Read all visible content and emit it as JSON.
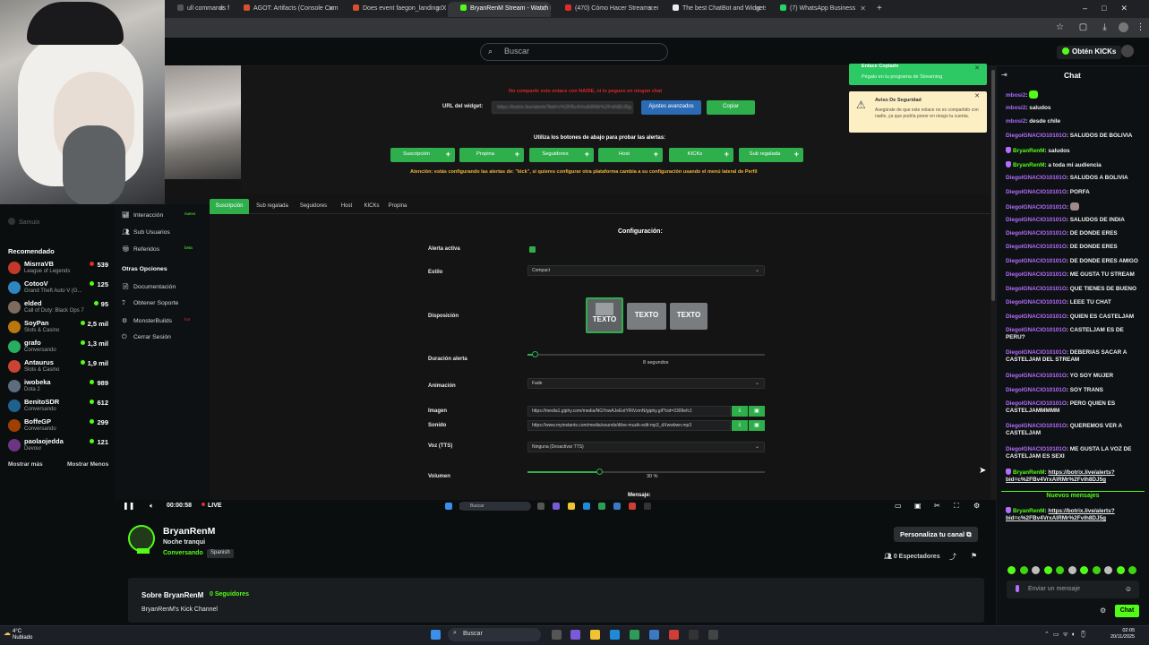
{
  "browser": {
    "tabs": [
      {
        "label": "ull commands for Cl",
        "active": false
      },
      {
        "label": "AGOT: Artifacts (Console Comm",
        "active": false
      },
      {
        "label": "Does event faegon_landing.007",
        "active": false
      },
      {
        "label": "BryanRenM Stream - Watch Liv",
        "active": true
      },
      {
        "label": "(470) Cómo Hacer Streams en",
        "active": false
      },
      {
        "label": "The best ChatBot and Widgets",
        "active": false
      },
      {
        "label": "(7) WhatsApp Business",
        "active": false
      }
    ],
    "new_tab": "+"
  },
  "header": {
    "search_placeholder": "Buscar",
    "get_kicks": "Obtén KICKs"
  },
  "sidebar": {
    "user": "Samuix",
    "recommended_title": "Recomendado",
    "channels": [
      {
        "name": "MisrraVB",
        "game": "League of Legends",
        "viewers": "539",
        "color": "#c0392b"
      },
      {
        "name": "CotooV",
        "game": "Grand Theft Auto V (G...",
        "viewers": "125",
        "color": "#2e86c1"
      },
      {
        "name": "elded",
        "game": "Call of Duty: Black Ops 7",
        "viewers": "95",
        "color": "#7d6b5d"
      },
      {
        "name": "SoyPan",
        "game": "Slots & Casino",
        "viewers": "2,5 mil",
        "color": "#b9770e"
      },
      {
        "name": "grafo",
        "game": "Conversando",
        "viewers": "1,3 mil",
        "color": "#27ae60"
      },
      {
        "name": "Antaurus",
        "game": "Slots & Casino",
        "viewers": "1,9 mil",
        "color": "#cb4335"
      },
      {
        "name": "iwobeka",
        "game": "Dota 2",
        "viewers": "989",
        "color": "#5d6d7e"
      },
      {
        "name": "BenitoSDR",
        "game": "Conversando",
        "viewers": "612",
        "color": "#1f618d"
      },
      {
        "name": "BoffeGP",
        "game": "Conversando",
        "viewers": "299",
        "color": "#a04000"
      },
      {
        "name": "paolaojedda",
        "game": "Devour",
        "viewers": "121",
        "color": "#6c3483"
      }
    ],
    "show_more": "Mostrar más",
    "show_less": "Mostrar Menos"
  },
  "dashboard": {
    "side_items": [
      {
        "label": "Interacción",
        "icon": "chart-icon",
        "tag": "nuevo"
      },
      {
        "label": "Sub Usuarios",
        "icon": "users-icon",
        "tag": ""
      },
      {
        "label": "Referidos",
        "icon": "gift-icon",
        "tag": "beta"
      },
      {
        "label": "Otras Opciones",
        "icon": "",
        "tag": ""
      },
      {
        "label": "Documentación",
        "icon": "doc-icon",
        "tag": ""
      },
      {
        "label": "Obtener Soporte",
        "icon": "help-icon",
        "tag": ""
      },
      {
        "label": "MonsterBuilds",
        "icon": "build-icon",
        "tag": "hot"
      },
      {
        "label": "Cerrar Sesión",
        "icon": "logout-icon",
        "tag": ""
      }
    ],
    "warning": "No compartir este enlace con NADIE, ni lo pegues en ningún chat",
    "url_label": "URL del widget:",
    "url_value": "https://botrix.live/alerts?bid=c%2FBv4VrxAIRMr%2Fvih8DJ5g",
    "advanced_button": "Ajustes avanzados",
    "copy_button": "Copiar",
    "test_caption": "Utiliza los botones de abajo para probar las alertas:",
    "test_buttons": [
      "Suscripción",
      "Propina",
      "Seguidores",
      "Host",
      "KICKs",
      "Sub regalada"
    ],
    "attention": "Atención: estás configurando las alertas de: \"kick\", si quieres configurar otra plataforma cambia a su configuración usando el menú lateral de Perfil",
    "tabs": [
      "Suscripción",
      "Sub regalada",
      "Seguidores",
      "Host",
      "KICKs",
      "Propina"
    ],
    "active_tab": "Suscripción",
    "config_title": "Configuración:",
    "fields": {
      "active_label": "Alerta activa",
      "style_label": "Estilo",
      "style_value": "Compact",
      "layout_label": "Disposición",
      "layout_option_text": "TEXTO",
      "duration_label": "Duración alerta",
      "duration_value": "8 segundos",
      "duration_fraction": 0.03,
      "animation_label": "Animación",
      "animation_value": "Fade",
      "image_label": "Imagen",
      "image_value": "https://media1.giphy.com/media/NGYowAJeEotYRtVzmN/giphy.gif?cid=3309efc1",
      "sound_label": "Sonido",
      "sound_value": "https://www.myinstants.com/media/sounds/dilve-muzik-edit-mp3_dXwwbwn.mp3",
      "tts_label": "Voz (TTS)",
      "tts_value": "Ninguna (Desactivar TTS)",
      "volume_label": "Volumen",
      "volume_value": "30 %",
      "volume_fraction": 0.3,
      "message_label": "Mensaje:"
    },
    "toasts": [
      {
        "title": "Enlace Copiado",
        "body": "Pégalo en tu programa de Streaming",
        "color": "#2cc964"
      },
      {
        "title": "Aviso De Seguridad",
        "body": "Asegúrate de que este enlace no es compartido con nadie, ya que podría poner en riesgo tu cuenta.",
        "color": "#fcefc4"
      }
    ]
  },
  "player": {
    "time": "00:00:58",
    "live": "LIVE"
  },
  "channel": {
    "name": "BryanRenM",
    "title": "Noche tranqui",
    "category": "Conversando",
    "language": "Spanish",
    "customize": "Personaliza tu canal",
    "viewers": "0 Espectadores",
    "about_title": "Sobre BryanRenM",
    "followers": "0 Seguidores",
    "description": "BryanRenM's Kick Channel"
  },
  "chat": {
    "title": "Chat",
    "messages": [
      {
        "user": "mbosi2",
        "text": "",
        "style": "p",
        "emote": true
      },
      {
        "user": "mbosi2",
        "text": "saludos",
        "style": "p"
      },
      {
        "user": "mbosi2",
        "text": "desde chile",
        "style": "p"
      },
      {
        "user": "DiegoIGNACIO10101O",
        "text": "SALUDOS DE BOLIVIA",
        "style": "u"
      },
      {
        "user": "BryanRenM",
        "text": "saludos",
        "style": "g",
        "badge": true
      },
      {
        "user": "BryanRenM",
        "text": "a toda mi audiencia",
        "style": "g",
        "badge": true
      },
      {
        "user": "DiegoIGNACIO10101O",
        "text": "SALUDOS A BOLIVIA",
        "style": "u"
      },
      {
        "user": "DiegoIGNACIO10101O",
        "text": "PORFA",
        "style": "u"
      },
      {
        "user": "DiegoIGNACIO10101O",
        "text": "",
        "style": "u",
        "pic": true
      },
      {
        "user": "DiegoIGNACIO10101O",
        "text": "SALUDOS DE INDIA",
        "style": "u"
      },
      {
        "user": "DiegoIGNACIO10101O",
        "text": "DE DONDE ERES",
        "style": "u"
      },
      {
        "user": "DiegoIGNACIO10101O",
        "text": "DE DONDE ERES",
        "style": "u"
      },
      {
        "user": "DiegoIGNACIO10101O",
        "text": "DE DONDE ERES AMIGO",
        "style": "u"
      },
      {
        "user": "DiegoIGNACIO10101O",
        "text": "ME GUSTA TU STREAM",
        "style": "u"
      },
      {
        "user": "DiegoIGNACIO10101O",
        "text": "QUE TIENES DE BUENO",
        "style": "u"
      },
      {
        "user": "DiegoIGNACIO10101O",
        "text": "LEEE TU CHAT",
        "style": "u"
      },
      {
        "user": "DiegoIGNACIO10101O",
        "text": "QUIEN ES CASTELJAM",
        "style": "u"
      },
      {
        "user": "DiegoIGNACIO10101O",
        "text": "CASTELJAM ES DE PERU?",
        "style": "u"
      },
      {
        "user": "DiegoIGNACIO10101O",
        "text": "DEBERIAS SACAR A CASTELJAM DEL STREAM",
        "style": "u"
      },
      {
        "user": "DiegoIGNACIO10101O",
        "text": "YO SOY MUJER",
        "style": "u"
      },
      {
        "user": "DiegoIGNACIO10101O",
        "text": "SOY TRANS",
        "style": "u"
      },
      {
        "user": "DiegoIGNACIO10101O",
        "text": "PERO QUIEN ES CASTELJAMMMMM",
        "style": "u"
      },
      {
        "user": "DiegoIGNACIO10101O",
        "text": "QUEREMOS VER A CASTELJAM",
        "style": "u"
      },
      {
        "user": "DiegoIGNACIO10101O",
        "text": "ME GUSTA LA VOZ DE CASTELJAM ES SEXI",
        "style": "u"
      },
      {
        "user": "BryanRenM",
        "text": "https://botrix.live/alerts?bid=c%2FBv4VrxAIRMr%2FvIh8DJ5g",
        "style": "g",
        "badge": true,
        "link": true
      }
    ],
    "new_messages": "Nuevos mensajes",
    "after_new": {
      "user": "BryanRenM",
      "text": "https://botrix.live/alerts?bid=c%2FBv4VrxAIRMr%2FvIh8DJ5g"
    },
    "input_placeholder": "Enviar un mensaje",
    "send": "Chat"
  },
  "taskbar": {
    "weather_temp": "4°C",
    "weather_desc": "Nublado",
    "search": "Buscar",
    "time": "02:05",
    "date": "20/11/2025"
  }
}
